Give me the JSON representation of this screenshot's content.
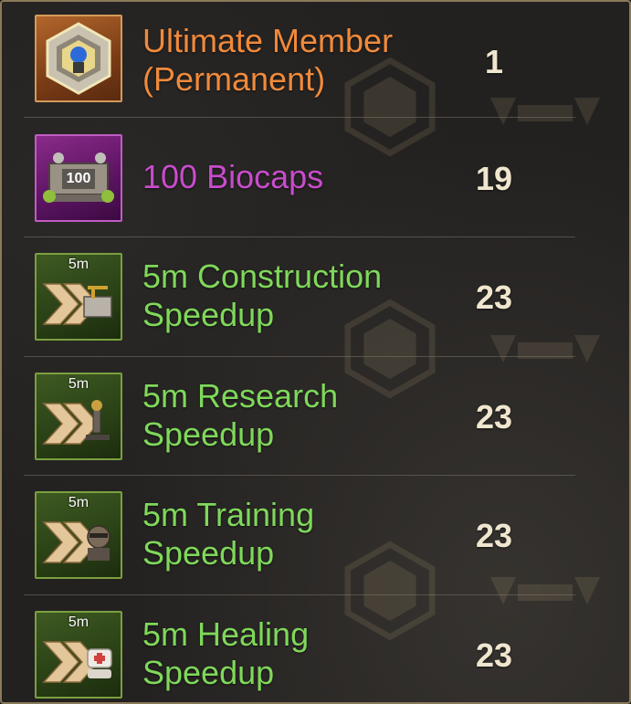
{
  "reward_list": {
    "items": [
      {
        "name_line1": "Ultimate Member",
        "name_line2": "(Permanent)",
        "quantity": "1",
        "rarity_color": "#f08a3c",
        "icon": "member-badge-icon"
      },
      {
        "name_line1": "100 Biocaps",
        "name_line2": "",
        "quantity": "19",
        "rarity_color": "#c84ccc",
        "icon": "biocaps-crate-icon",
        "icon_label": "100"
      },
      {
        "name_line1": "5m Construction",
        "name_line2": "Speedup",
        "quantity": "23",
        "rarity_color": "#7fd85a",
        "icon": "construction-speedup-icon",
        "icon_label": "5m"
      },
      {
        "name_line1": "5m Research",
        "name_line2": "Speedup",
        "quantity": "23",
        "rarity_color": "#7fd85a",
        "icon": "research-speedup-icon",
        "icon_label": "5m"
      },
      {
        "name_line1": "5m Training",
        "name_line2": "Speedup",
        "quantity": "23",
        "rarity_color": "#7fd85a",
        "icon": "training-speedup-icon",
        "icon_label": "5m"
      },
      {
        "name_line1": "5m Healing",
        "name_line2": "Speedup",
        "quantity": "23",
        "rarity_color": "#7fd85a",
        "icon": "healing-speedup-icon",
        "icon_label": "5m"
      }
    ]
  },
  "colors": {
    "panel_border": "#8a7a5a",
    "quantity_text": "#f0e6cf"
  }
}
